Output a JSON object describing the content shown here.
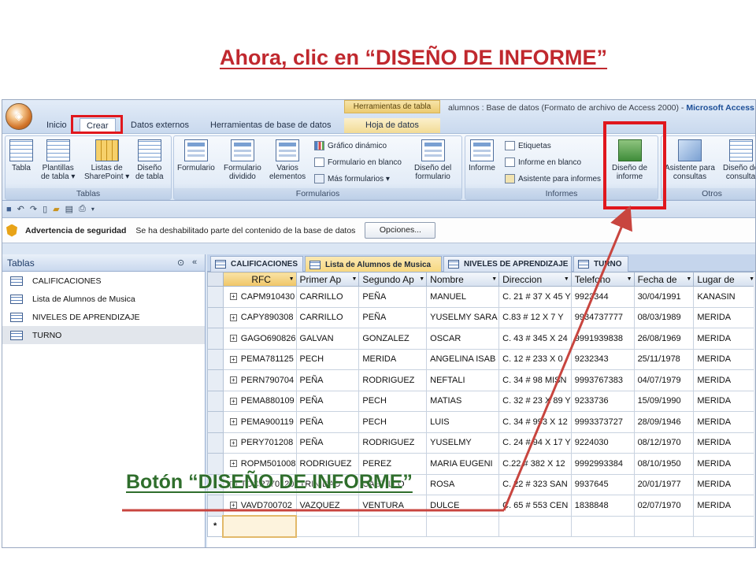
{
  "slide": {
    "title": "Ahora, clic en “DISEÑO DE INFORME”",
    "caption": "Botón “DISEÑO DE INFORME”"
  },
  "titlebar": {
    "context_tab": "Herramientas de tabla",
    "window_title": "alumnos : Base de datos (Formato de archivo de Access 2000) - ",
    "app_name": "Microsoft Access"
  },
  "tabs": [
    "Inicio",
    "Crear",
    "Datos externos",
    "Herramientas de base de datos",
    "Hoja de datos"
  ],
  "ribbon": {
    "tablas": {
      "label": "Tablas",
      "buttons": [
        {
          "line1": "Tabla",
          "line2": ""
        },
        {
          "line1": "Plantillas",
          "line2": "de tabla ▾"
        },
        {
          "line1": "Listas de",
          "line2": "SharePoint ▾"
        },
        {
          "line1": "Diseño",
          "line2": "de tabla"
        }
      ]
    },
    "formularios": {
      "label": "Formularios",
      "buttons": [
        {
          "line1": "Formulario",
          "line2": ""
        },
        {
          "line1": "Formulario",
          "line2": "dividido"
        },
        {
          "line1": "Varios",
          "line2": "elementos"
        }
      ],
      "small": [
        "Gráfico dinámico",
        "Formulario en blanco",
        "Más formularios ▾"
      ],
      "diseno": {
        "line1": "Diseño del",
        "line2": "formulario"
      }
    },
    "informes": {
      "label": "Informes",
      "informe": "Informe",
      "small": [
        "Etiquetas",
        "Informe en blanco",
        "Asistente para informes"
      ],
      "diseno": {
        "line1": "Diseño de",
        "line2": "informe"
      }
    },
    "otros": {
      "label": "Otros",
      "buttons": [
        {
          "line1": "Asistente para",
          "line2": "consultas"
        },
        {
          "line1": "Diseño de",
          "line2": "consulta"
        }
      ]
    }
  },
  "security": {
    "title": "Advertencia de seguridad",
    "message": "Se ha deshabilitado parte del contenido de la base de datos",
    "button": "Opciones..."
  },
  "nav": {
    "header": "Tablas",
    "items": [
      "CALIFICACIONES",
      "Lista de Alumnos de Musica",
      "NIVELES DE APRENDIZAJE",
      "TURNO"
    ]
  },
  "doc_tabs": [
    "CALIFICACIONES",
    "Lista de Alumnos de Musica",
    "NIVELES DE APRENDIZAJE",
    "TURNO"
  ],
  "table": {
    "columns": [
      "RFC",
      "Primer Ap",
      "Segundo Ap",
      "Nombre",
      "Direccion",
      "Telefono",
      "Fecha de",
      "Lugar de"
    ],
    "rows": [
      [
        "CAPM910430",
        "CARRILLO",
        "PEÑA",
        "MANUEL",
        "C. 21 # 37 X 45 Y",
        "9923344",
        "30/04/1991",
        "KANASIN"
      ],
      [
        "CAPY890308",
        "CARRILLO",
        "PEÑA",
        "YUSELMY SARA",
        "C.83 # 12 X 7 Y",
        "9934737777",
        "08/03/1989",
        "MERIDA"
      ],
      [
        "GAGO690826",
        "GALVAN",
        "GONZALEZ",
        "OSCAR",
        "C. 43 # 345 X 24",
        "9991939838",
        "26/08/1969",
        "MERIDA"
      ],
      [
        "PEMA781125",
        "PECH",
        "MERIDA",
        "ANGELINA ISAB",
        "C. 12 # 233 X 0",
        "9232343",
        "25/11/1978",
        "MERIDA"
      ],
      [
        "PERN790704",
        "PEÑA",
        "RODRIGUEZ",
        "NEFTALI",
        "C. 34 # 98 MISN",
        "9993767383",
        "04/07/1979",
        "MERIDA"
      ],
      [
        "PEMA880109",
        "PEÑA",
        "PECH",
        "MATIAS",
        "C. 32 # 23 X 89 Y",
        "9233736",
        "15/09/1990",
        "MERIDA"
      ],
      [
        "PEMA900119",
        "PEÑA",
        "PECH",
        "LUIS",
        "C. 34 # 993 X 12",
        "9993373727",
        "28/09/1946",
        "MERIDA"
      ],
      [
        "PERY701208",
        "PEÑA",
        "RODRIGUEZ",
        "YUSELMY",
        "C. 24 # 94 X 17 Y",
        "9224030",
        "08/12/1970",
        "MERIDA"
      ],
      [
        "ROPM501008",
        "RODRIGUEZ",
        "PEREZ",
        "MARIA EUGENI",
        "C.22 # 382 X 12",
        "9992993384",
        "08/10/1950",
        "MERIDA"
      ],
      [
        "TOCR770120",
        "TRINIDAD",
        "CASTILLO",
        "ROSA",
        "C. 22 # 323 SAN",
        "9937645",
        "20/01/1977",
        "MERIDA"
      ],
      [
        "VAVD700702",
        "VAZQUEZ",
        "VENTURA",
        "DULCE",
        "C. 65 # 553 CEN",
        "1838848",
        "02/07/1970",
        "MERIDA"
      ]
    ],
    "new_row_marker": "*"
  },
  "colors": {
    "title_red": "#c0282e",
    "caption_green": "#2f6e2c",
    "highlight_red": "#e0171d"
  }
}
